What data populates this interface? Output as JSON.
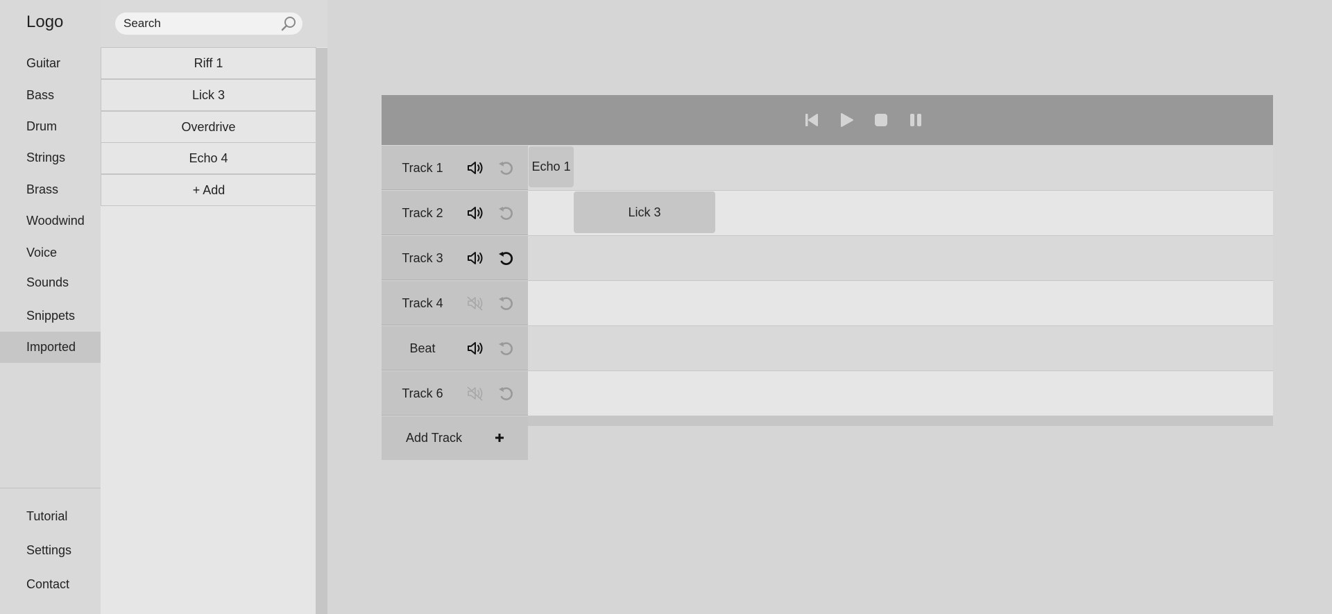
{
  "nav": {
    "logo": "Logo",
    "items": [
      "Guitar",
      "Bass",
      "Drum",
      "Strings",
      "Brass",
      "Woodwind",
      "Voice",
      "Sounds",
      "Snippets",
      "Imported"
    ],
    "active": "Imported",
    "bottom_items": [
      "Tutorial",
      "Settings",
      "Contact"
    ]
  },
  "library": {
    "search_placeholder": "Search",
    "items": [
      "Riff 1",
      "Lick 3",
      "Overdrive",
      "Echo 4"
    ],
    "add_label": "+ Add"
  },
  "transport": {
    "icons": [
      "skip-back-icon",
      "play-icon",
      "stop-icon",
      "pause-icon"
    ]
  },
  "tracks": [
    {
      "name": "Track 1",
      "muted": false,
      "loop": false
    },
    {
      "name": "Track 2",
      "muted": false,
      "loop": false
    },
    {
      "name": "Track 3",
      "muted": false,
      "loop": true
    },
    {
      "name": "Track 4",
      "muted": true,
      "loop": false
    },
    {
      "name": "Beat",
      "muted": false,
      "loop": false
    },
    {
      "name": "Track 6",
      "muted": true,
      "loop": false
    }
  ],
  "clips": [
    {
      "label": "Echo 1",
      "track": "Track 1"
    },
    {
      "label": "Lick 3",
      "track": "Track 2"
    }
  ],
  "add_track_label": "Add Track",
  "colors": {
    "background": "#d6d6d6",
    "transport_bar": "#989898",
    "active_nav": "#c6c6c6",
    "icon_active": "#111111",
    "icon_inactive": "#999999"
  }
}
